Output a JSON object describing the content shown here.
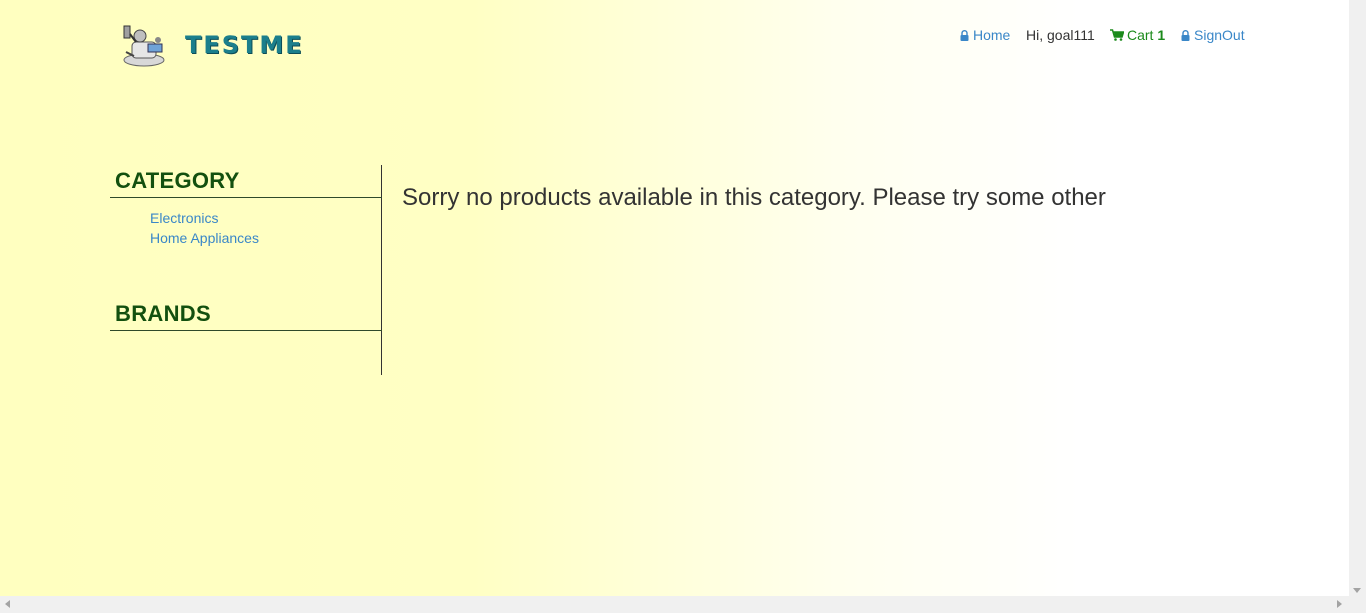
{
  "brand": {
    "logo_text": "TESTME"
  },
  "nav": {
    "home": "Home",
    "greeting": "Hi, goal111",
    "cart_label": "Cart",
    "cart_count": "1",
    "signout": "SignOut"
  },
  "sidebar": {
    "category_title": "CATEGORY",
    "categories": [
      "Electronics",
      "Home Appliances"
    ],
    "brands_title": "BRANDS"
  },
  "main": {
    "message": "Sorry no products available in this category. Please try some other"
  },
  "colors": {
    "link": "#3a87c8",
    "heading_green": "#13500f",
    "cart_green": "#1b8a1b",
    "logo_teal": "#1b7f8c"
  }
}
